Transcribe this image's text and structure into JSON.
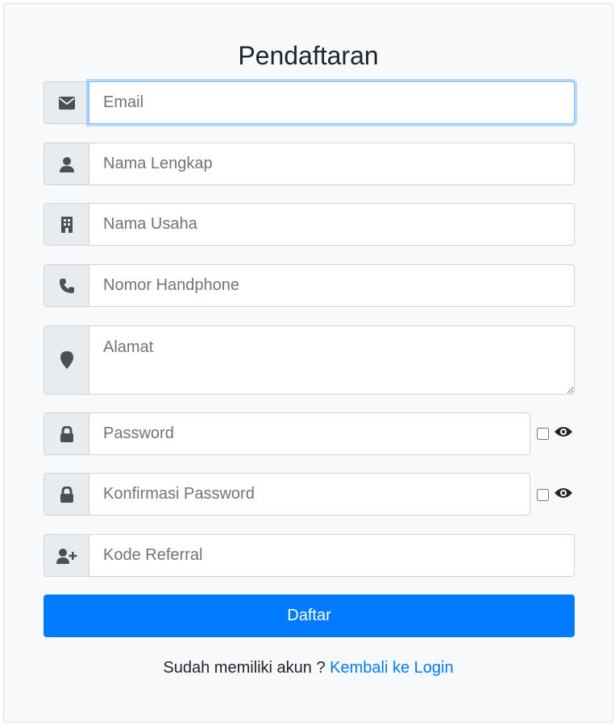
{
  "form": {
    "title": "Pendaftaran",
    "fields": [
      {
        "icon": "envelope-icon",
        "placeholder": "Email"
      },
      {
        "icon": "user-icon",
        "placeholder": "Nama Lengkap"
      },
      {
        "icon": "building-icon",
        "placeholder": "Nama Usaha"
      },
      {
        "icon": "phone-icon",
        "placeholder": "Nomor Handphone"
      },
      {
        "icon": "map-marker-icon",
        "placeholder": "Alamat"
      },
      {
        "icon": "lock-icon",
        "placeholder": "Password"
      },
      {
        "icon": "lock-icon",
        "placeholder": "Konfirmasi Password"
      },
      {
        "icon": "user-plus-icon",
        "placeholder": "Kode Referral"
      }
    ],
    "submit_label": "Daftar",
    "footer_text": "Sudah memiliki akun ? ",
    "login_link": "Kembali ke Login"
  },
  "colors": {
    "primary": "#007bff",
    "addon_bg": "#e9ecef",
    "border": "#ced4da",
    "card_bg": "#f7f9fb"
  }
}
